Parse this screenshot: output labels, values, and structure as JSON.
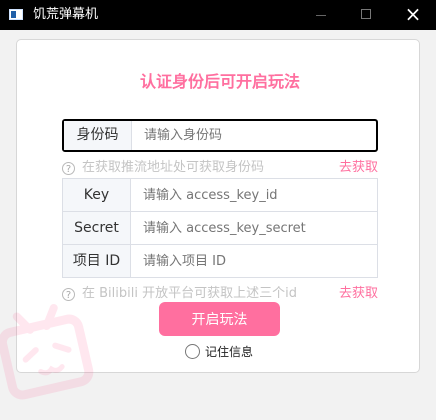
{
  "window": {
    "title": "饥荒弹幕机",
    "controls": {
      "minimize": "—",
      "maximize": "□",
      "close": "×"
    }
  },
  "panel": {
    "heading": "认证身份后可开启玩法",
    "fields": [
      {
        "label": "身份码",
        "placeholder": "请输入身份码"
      },
      {
        "label": "Key",
        "placeholder": "请输入 access_key_id"
      },
      {
        "label": "Secret",
        "placeholder": "请输入 access_key_secret"
      },
      {
        "label": "项目 ID",
        "placeholder": "请输入项目 ID"
      }
    ],
    "hints": [
      {
        "text": "在获取推流地址处可获取身份码",
        "link": "去获取"
      },
      {
        "text": "在 Bilibili 开放平台可获取上述三个id",
        "link": "去获取"
      }
    ],
    "start_button": "开启玩法",
    "remember_label": "记住信息"
  },
  "colors": {
    "accent": "#ff6f9f",
    "hint": "#c4c4c4",
    "titlebar": "#000000"
  },
  "icons": {
    "app": "window-app-icon",
    "help": "question-circle-icon",
    "watermark": "bilibili-tv-icon"
  }
}
